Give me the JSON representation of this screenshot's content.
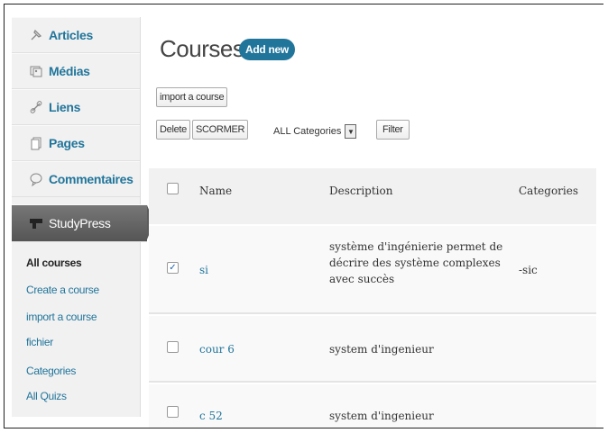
{
  "sidebar": {
    "items": [
      {
        "label": "Articles",
        "icon": "pin-icon"
      },
      {
        "label": "Médias",
        "icon": "media-icon"
      },
      {
        "label": "Liens",
        "icon": "link-icon"
      },
      {
        "label": "Pages",
        "icon": "page-icon"
      },
      {
        "label": "Commentaires",
        "icon": "comment-icon"
      },
      {
        "label": "StudyPress",
        "icon": "studypress-icon"
      }
    ],
    "submenu": [
      "All courses",
      "Create a course",
      "import a course",
      "fichier",
      "Categories",
      "All Quizs"
    ]
  },
  "page": {
    "title": "Courses",
    "add_new": "Add new"
  },
  "toolbar": {
    "import": "import a course",
    "delete": "Delete",
    "scormer": "SCORMER",
    "category_select": "ALL Categories",
    "filter": "Filter"
  },
  "table": {
    "headers": {
      "name": "Name",
      "description": "Description",
      "categories": "Categories"
    },
    "rows": [
      {
        "name": "si",
        "description": [
          "système d'ingénierie permet de",
          "décrire des système complexes",
          "avec succès"
        ],
        "categories": "-sic",
        "checked": true
      },
      {
        "name": "cour 6",
        "description": [
          "system d'ingenieur"
        ],
        "categories": "",
        "checked": false
      },
      {
        "name": "c 52",
        "description": [
          "system d'ingenieur"
        ],
        "categories": "",
        "checked": false
      }
    ]
  },
  "colors": {
    "link": "#21759b",
    "accent": "#21759b",
    "active_menu": "#5c5c5c"
  }
}
